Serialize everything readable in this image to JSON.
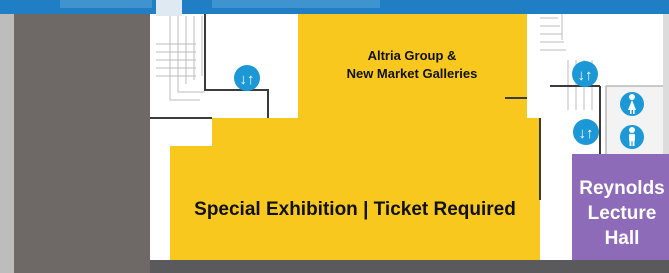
{
  "map": {
    "colors": {
      "top_band": "#1f7ec4",
      "left_wall": "#6e6866",
      "floor_border": "#5a5a5c",
      "gallery": "#f8c81e",
      "lecture_hall": "#8e6bb8",
      "icon_circle": "#1b98d5",
      "stairs": "#bcbcbc",
      "wall_outline": "#3b3b3b"
    },
    "rooms": {
      "altria": {
        "line1": "Altria Group &",
        "line2": "New Market Galleries"
      },
      "special_exhibition": {
        "label": "Special Exhibition | Ticket Required"
      },
      "reynolds": {
        "line1": "Reynolds",
        "line2": "Lecture",
        "line3": "Hall"
      }
    },
    "icons": [
      {
        "name": "elevator-icon",
        "symbol": "↓↑"
      },
      {
        "name": "elevator-icon",
        "symbol": "↓↑"
      },
      {
        "name": "elevator-icon",
        "symbol": "↓↑"
      },
      {
        "name": "womens-restroom-icon",
        "symbol": "female"
      },
      {
        "name": "mens-restroom-icon",
        "symbol": "male"
      }
    ]
  }
}
